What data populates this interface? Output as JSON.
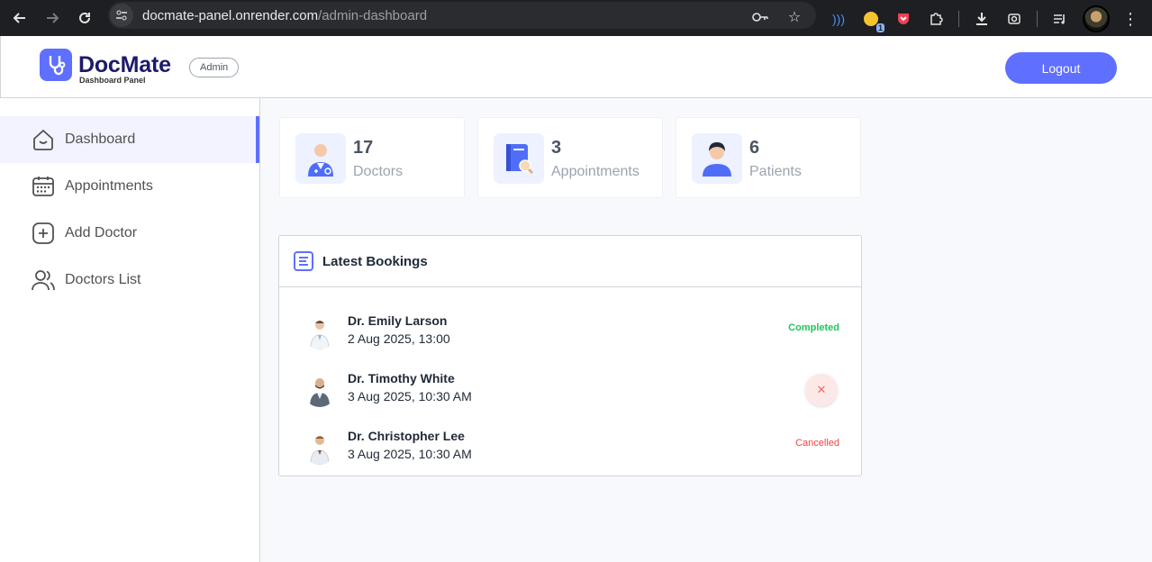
{
  "browser": {
    "url_host": "docmate-panel.onrender.com",
    "url_path": "/admin-dashboard",
    "extension_badge": "1"
  },
  "header": {
    "logo_title": "DocMate",
    "logo_subtitle": "Dashboard Panel",
    "role": "Admin",
    "logout_label": "Logout",
    "accent": "#5f6fff"
  },
  "sidebar": {
    "items": [
      {
        "label": "Dashboard",
        "icon": "home-icon",
        "active": true
      },
      {
        "label": "Appointments",
        "icon": "calendar-icon",
        "active": false
      },
      {
        "label": "Add Doctor",
        "icon": "add-icon",
        "active": false
      },
      {
        "label": "Doctors List",
        "icon": "people-icon",
        "active": false
      }
    ]
  },
  "stats": [
    {
      "value": "17",
      "label": "Doctors",
      "icon": "doctor-icon"
    },
    {
      "value": "3",
      "label": "Appointments",
      "icon": "appointment-book-icon"
    },
    {
      "value": "6",
      "label": "Patients",
      "icon": "patient-icon"
    }
  ],
  "bookings": {
    "title": "Latest Bookings",
    "rows": [
      {
        "doctor": "Dr. Emily Larson",
        "date": "2 Aug 2025, 13:00",
        "status": "Completed",
        "status_color": "#22c55e"
      },
      {
        "doctor": "Dr. Timothy White",
        "date": "3 Aug 2025, 10:30 AM",
        "status": "",
        "action": "cancel-icon"
      },
      {
        "doctor": "Dr. Christopher Lee",
        "date": "3 Aug 2025, 10:30 AM",
        "status": "Cancelled",
        "status_color": "#ef4444"
      }
    ]
  }
}
